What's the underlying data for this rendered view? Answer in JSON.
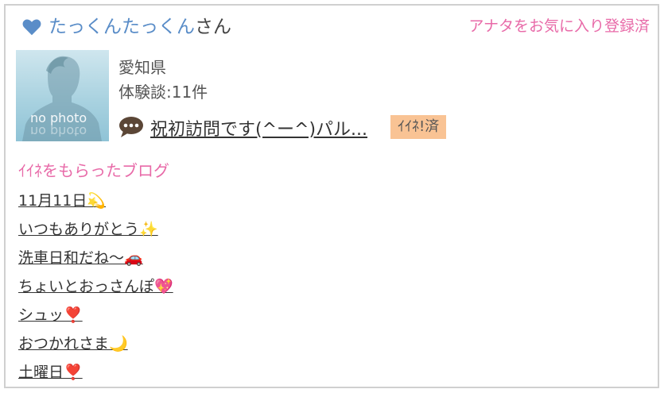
{
  "profile": {
    "username": "たっくんたっくん",
    "suffix": "さん",
    "favorite_label": "アナタをお気に入り登録済",
    "avatar_text": "no photo",
    "prefecture": "愛知県",
    "reviews": "体験談:11件",
    "latest_post": "祝初訪問です(^ー^)パル...",
    "iine_badge": "ｲｲﾈ!済"
  },
  "liked_blogs": {
    "title": "ｲｲﾈをもらったブログ",
    "items": [
      "11月11日💫",
      "いつもありがとう✨",
      "洗車日和だね〜🚗",
      "ちょいとおっさんぽ💖",
      "シュッ❣️",
      "おつかれさま🌙",
      "土曜日❣️"
    ]
  },
  "colors": {
    "name_blue": "#5a8dc8",
    "pink": "#e86aa8",
    "badge_orange": "#f9c394"
  },
  "icons": {
    "favorite": "heart-icon",
    "post": "speech-bubble-icon"
  }
}
